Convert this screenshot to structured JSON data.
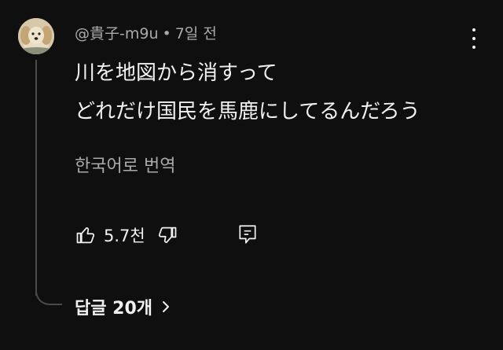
{
  "comment": {
    "author": "@貴子-m9u",
    "separator": "•",
    "time": "7일 전",
    "lines": [
      "川を地図から消すって",
      "どれだけ国民を馬鹿にしてるんだろう"
    ],
    "translate_label": "한국어로 번역",
    "like_count": "5.7천",
    "replies_label": "답글 20개"
  },
  "icons": {
    "more": "more-vert-icon",
    "like": "thumb-up-icon",
    "dislike": "thumb-down-icon",
    "reply": "reply-comment-icon",
    "chevron": "chevron-right-icon"
  },
  "colors": {
    "background": "#0f0f0f",
    "primary_text": "#f1f1f1",
    "secondary_text": "#aaaaaa",
    "thread_line": "#4a4a4a"
  }
}
